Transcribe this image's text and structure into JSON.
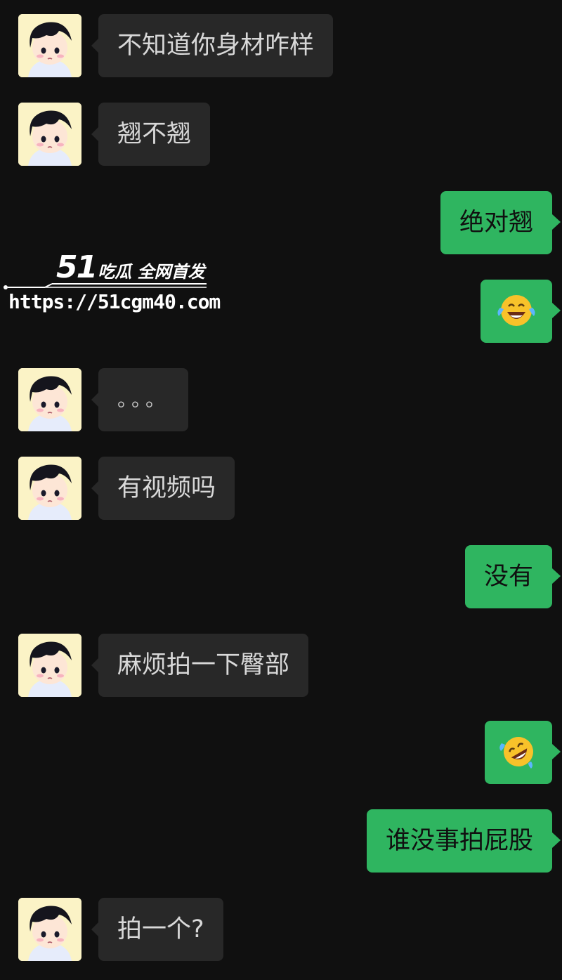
{
  "messages": [
    {
      "side": "in",
      "text": "不知道你身材咋样"
    },
    {
      "side": "in",
      "text": "翘不翘"
    },
    {
      "side": "out",
      "text": "绝对翘"
    },
    {
      "side": "out",
      "emoji": "tears-of-joy-emoji"
    },
    {
      "side": "in",
      "text": "。。。"
    },
    {
      "side": "in",
      "text": "有视频吗"
    },
    {
      "side": "out",
      "text": "没有"
    },
    {
      "side": "in",
      "text": "麻烦拍一下臀部"
    },
    {
      "side": "out",
      "emoji": "rolling-on-floor-laughing-emoji"
    },
    {
      "side": "out",
      "text": "谁没事拍屁股"
    },
    {
      "side": "in",
      "text": "拍一个?"
    }
  ],
  "watermark": {
    "logo_number": "51",
    "logo_text": "吃瓜 全网首发",
    "url": "https://51cgm40.com"
  },
  "colors": {
    "background": "#101010",
    "incoming_bubble": "#282828",
    "outgoing_bubble": "#2fb560",
    "avatar_bg": "#fbf3c6"
  },
  "icons": {
    "contact_avatar": "cartoon-boy-avatar"
  }
}
